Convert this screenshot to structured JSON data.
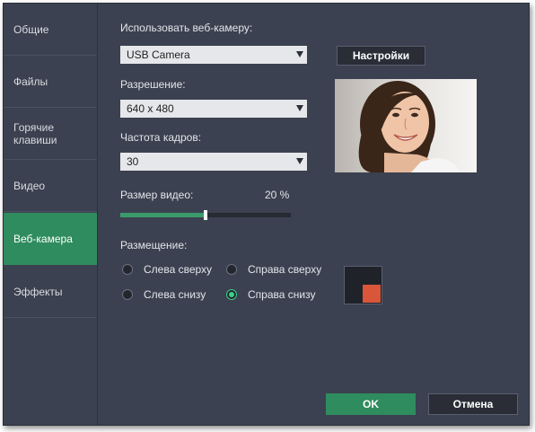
{
  "sidebar": {
    "items": [
      {
        "label": "Общие"
      },
      {
        "label": "Файлы"
      },
      {
        "label": "Горячие\nклавиши"
      },
      {
        "label": "Видео"
      },
      {
        "label": "Веб-камера"
      },
      {
        "label": "Эффекты"
      }
    ],
    "active_index": 4
  },
  "webcam": {
    "camera_label": "Использовать веб-камеру:",
    "camera_value": "USB Camera",
    "settings_button": "Настройки",
    "resolution_label": "Разрешение:",
    "resolution_value": "640 x 480",
    "fps_label": "Частота кадров:",
    "fps_value": "30",
    "size_label": "Размер видео:",
    "size_value": "20 %",
    "size_fraction": 0.5,
    "placement_label": "Размещение:",
    "placement_options": [
      "Слева сверху",
      "Справа сверху",
      "Слева снизу",
      "Справа снизу"
    ],
    "placement_selected": "Справа снизу",
    "preview_image": "smiling-woman-photo",
    "marker_color": "#d9563a"
  },
  "footer": {
    "ok_label": "OK",
    "cancel_label": "Отмена"
  },
  "colors": {
    "accent": "#2f8c5e",
    "background": "#3b4150"
  }
}
